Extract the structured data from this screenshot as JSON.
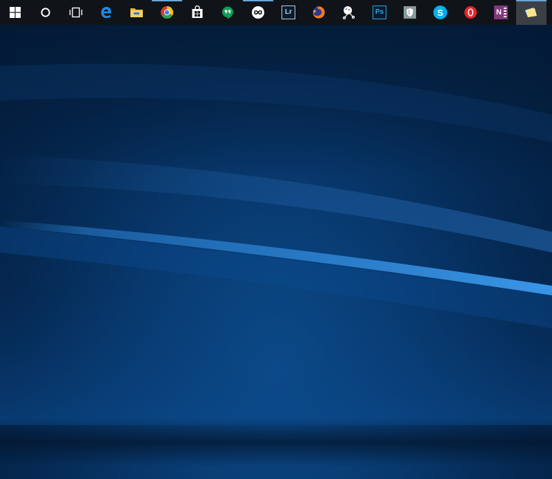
{
  "taskbar": {
    "background": "#101418",
    "running_indicator": "#6aa6d8",
    "items": [
      {
        "name": "start-button",
        "icon": "windows-logo-icon"
      },
      {
        "name": "cortana-search-button",
        "icon": "cortana-circle-icon"
      },
      {
        "name": "task-view-button",
        "icon": "task-view-icon"
      },
      {
        "name": "edge-browser",
        "icon": "edge-icon",
        "running": false
      },
      {
        "name": "file-explorer",
        "icon": "folder-icon",
        "running": false
      },
      {
        "name": "chrome-browser",
        "icon": "chrome-icon",
        "running": true
      },
      {
        "name": "windows-store",
        "icon": "store-bag-icon",
        "running": false
      },
      {
        "name": "hangouts",
        "icon": "hangouts-icon",
        "running": false
      },
      {
        "name": "infinity-app",
        "icon": "infinity-icon",
        "running": true
      },
      {
        "name": "lightroom",
        "icon": "lightroom-icon",
        "label": "Lr",
        "running": false
      },
      {
        "name": "firefox-browser",
        "icon": "firefox-icon",
        "running": false
      },
      {
        "name": "snipping-tool",
        "icon": "scissors-icon",
        "running": false
      },
      {
        "name": "photoshop",
        "icon": "photoshop-icon",
        "label": "Ps",
        "running": false
      },
      {
        "name": "shield-app",
        "icon": "shield-icon",
        "running": false
      },
      {
        "name": "skype",
        "icon": "skype-icon",
        "label": "S",
        "running": false
      },
      {
        "name": "opera-browser",
        "icon": "opera-icon",
        "running": false
      },
      {
        "name": "onenote",
        "icon": "onenote-icon",
        "label": "N",
        "running": false
      },
      {
        "name": "sticky-notes",
        "icon": "sticky-notes-icon",
        "running": true,
        "active": true
      }
    ]
  },
  "desktop": {
    "wallpaper": "windows-10-hero-wallpaper",
    "colors": {
      "base": "#06284f",
      "glow": "#2f8be0"
    }
  }
}
